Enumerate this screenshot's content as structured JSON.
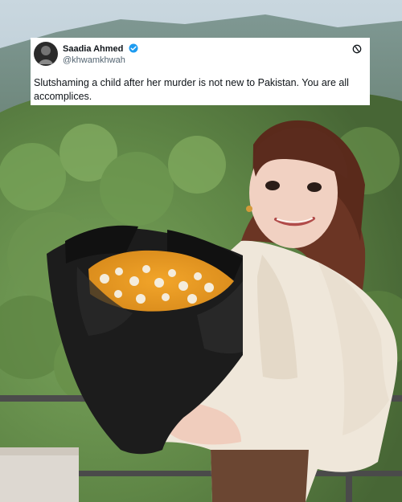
{
  "tweet": {
    "author_name": "Saadia Ahmed",
    "author_handle": "@khwamkhwah",
    "text": "Slutshaming a child after her murder is not new to Pakistan. You are all accomplices.",
    "verified_color": "#1d9bf0",
    "avatar_icon": "profile-avatar",
    "badge_icon": "verified-badge-icon",
    "action_icon": "threads-icon"
  }
}
